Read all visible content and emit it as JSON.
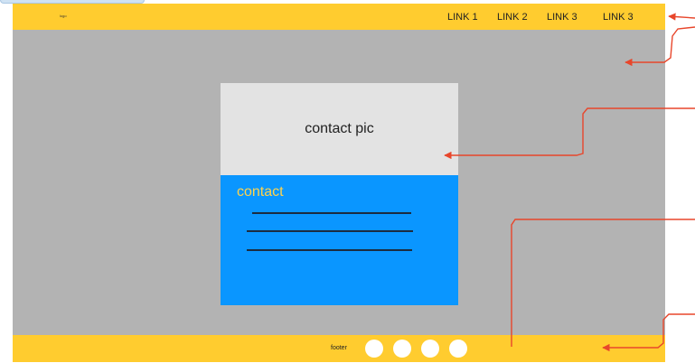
{
  "header": {
    "logo_text": "logo",
    "nav_links": [
      "LINK 1",
      "LINK 2",
      "LINK 3",
      "LINK 3"
    ]
  },
  "card": {
    "pic_label": "contact pic",
    "title": "contact"
  },
  "footer": {
    "text": "footer",
    "social_icon_count": 4
  },
  "colors": {
    "header_footer": "#ffcc2f",
    "main_background": "#b3b3b3",
    "card_pic": "#e3e3e3",
    "card_body": "#0a96ff",
    "card_title": "#ffd34d",
    "annotation_arrows": "#e8462b"
  },
  "annotations": {
    "arrow_count": 5
  }
}
